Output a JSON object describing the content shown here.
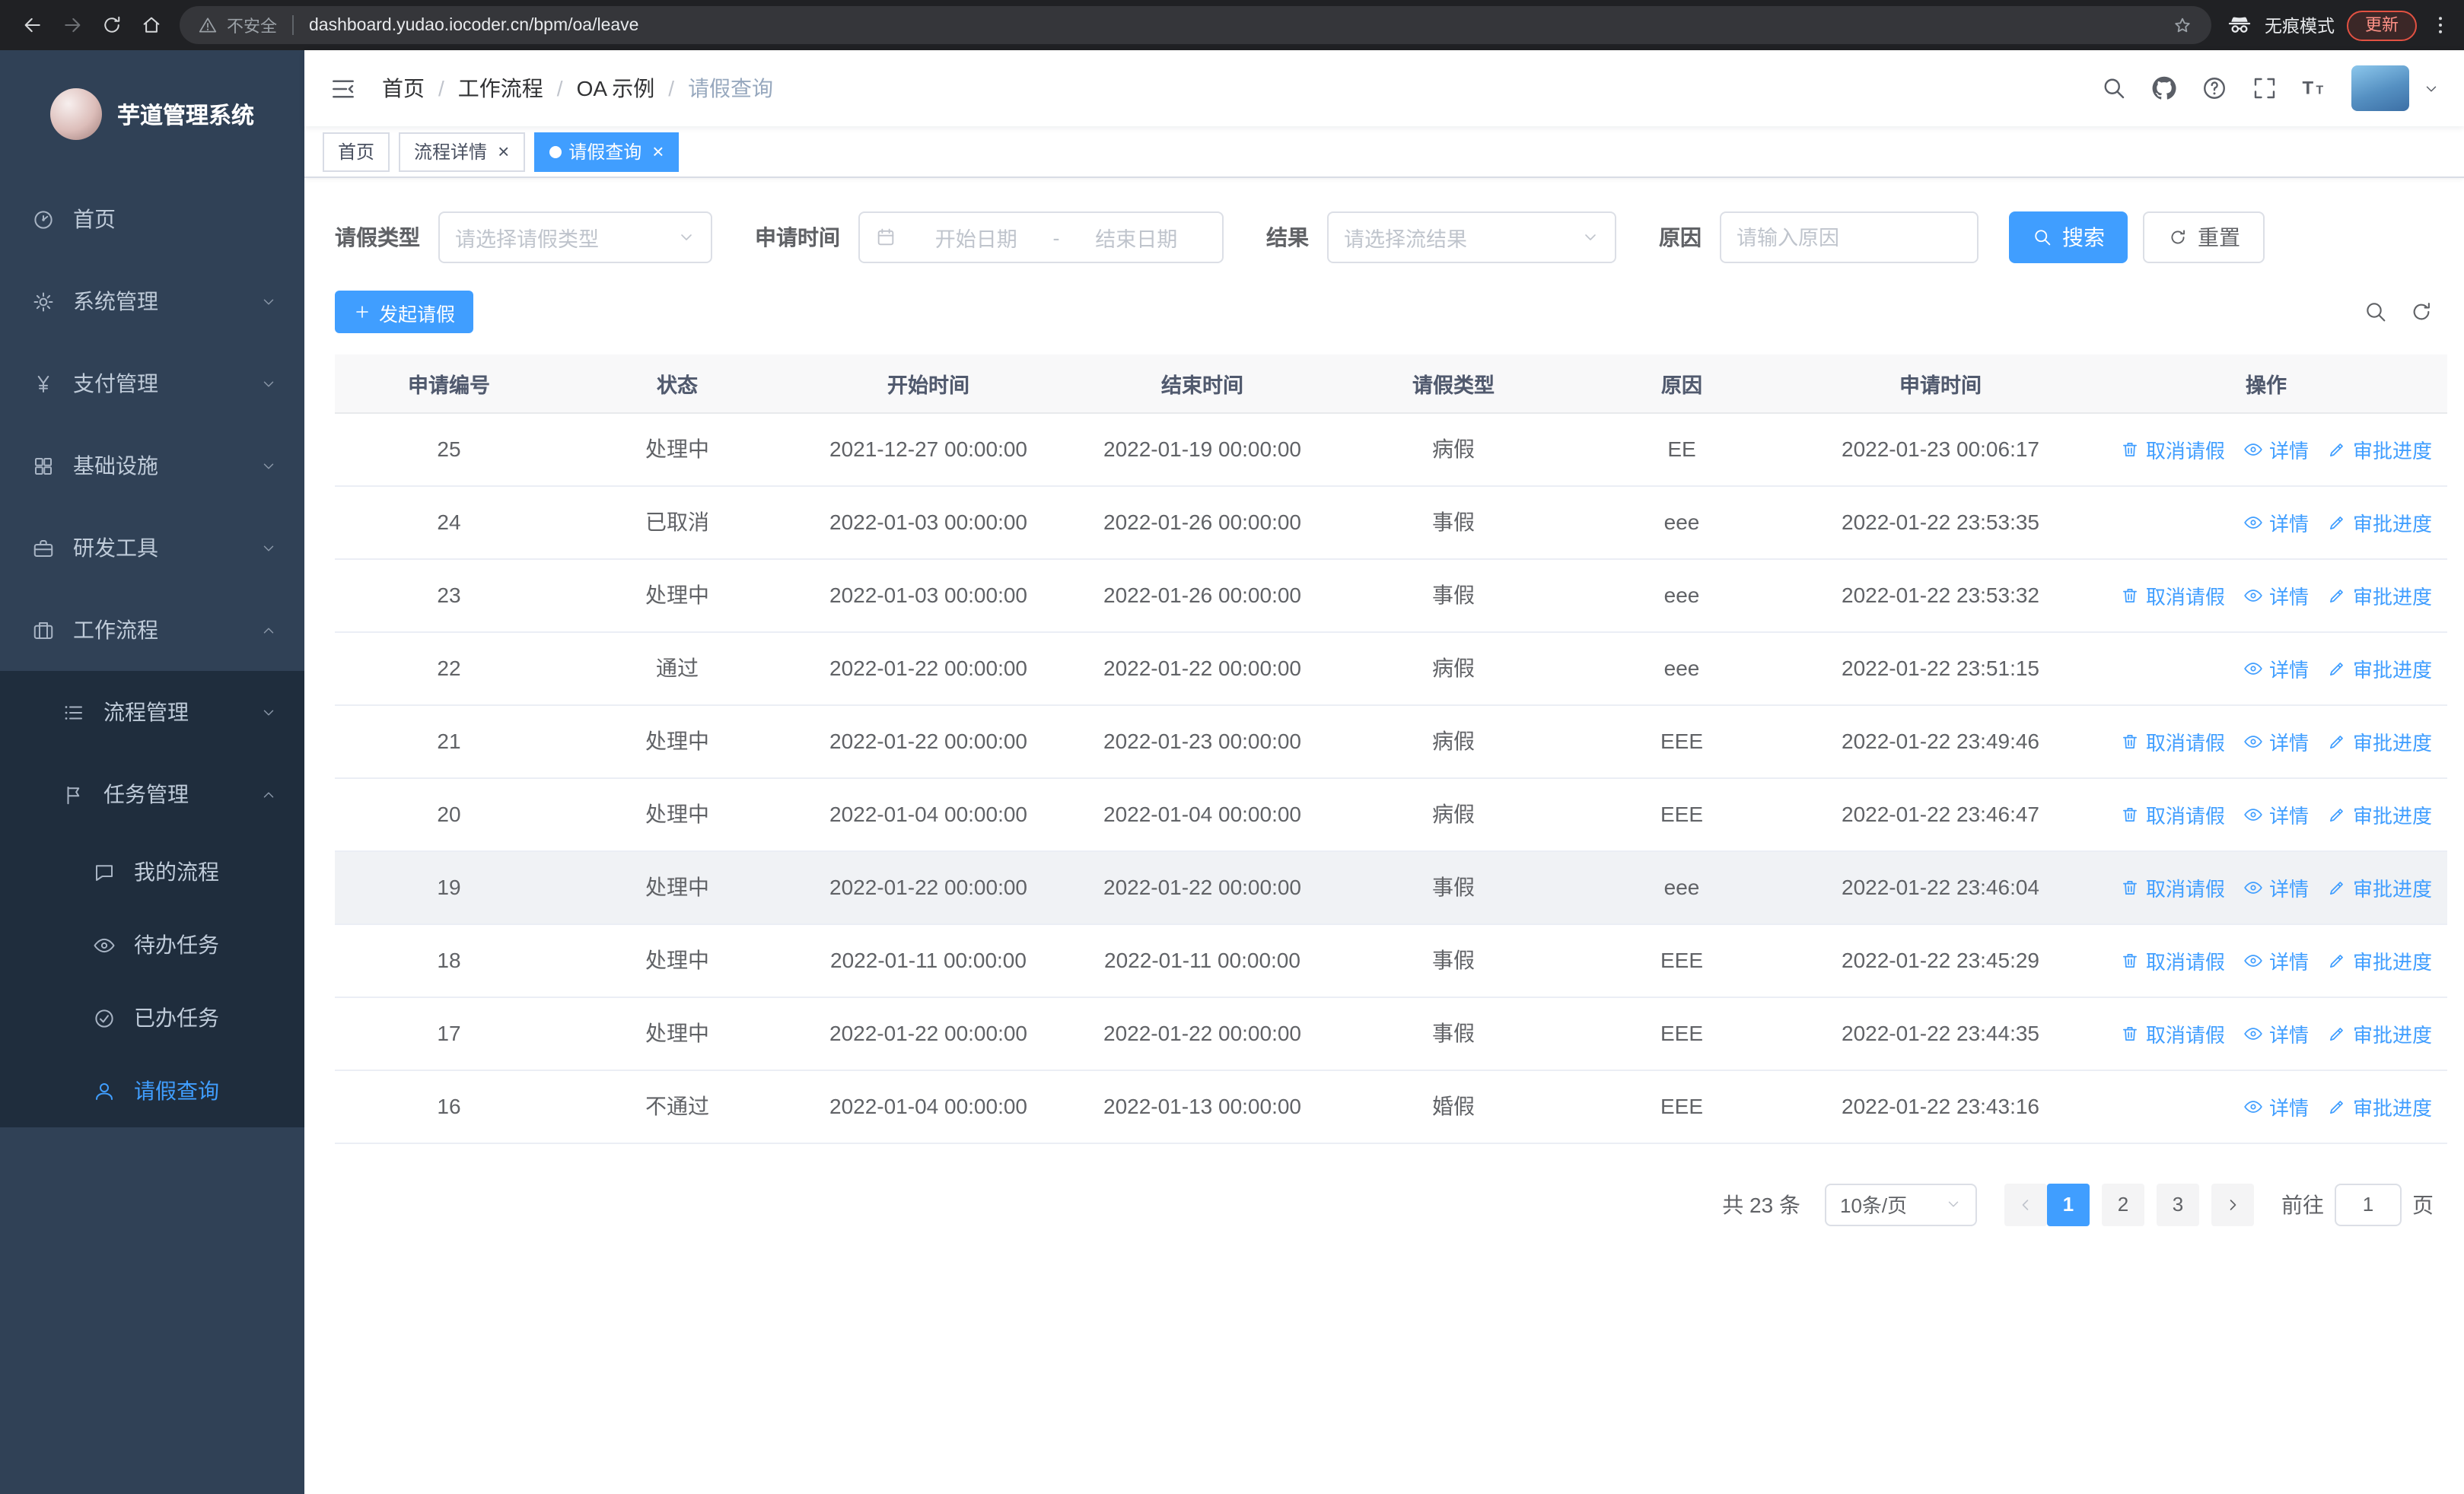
{
  "colors": {
    "primary": "#409eff",
    "sidebar_bg": "#304156",
    "submenu_bg": "#1f2d3d",
    "tab_active_bg": "#409eff"
  },
  "browser": {
    "security_label": "不安全",
    "url": "dashboard.yudao.iocoder.cn/bpm/oa/leave",
    "incognito_label": "无痕模式",
    "update_label": "更新"
  },
  "sidebar": {
    "logo_title": "芋道管理系统",
    "menu": [
      {
        "name": "home",
        "label": "首页",
        "icon": "dashboard-icon",
        "level": 1,
        "expandable": false,
        "expanded": false,
        "active": false
      },
      {
        "name": "system-mgmt",
        "label": "系统管理",
        "icon": "gear-icon",
        "level": 1,
        "expandable": true,
        "expanded": false,
        "active": false
      },
      {
        "name": "payment-mgmt",
        "label": "支付管理",
        "icon": "yen-icon",
        "level": 1,
        "expandable": true,
        "expanded": false,
        "active": false
      },
      {
        "name": "infrastructure",
        "label": "基础设施",
        "icon": "grid-icon",
        "level": 1,
        "expandable": true,
        "expanded": false,
        "active": false
      },
      {
        "name": "dev-tools",
        "label": "研发工具",
        "icon": "briefcase-icon",
        "level": 1,
        "expandable": true,
        "expanded": false,
        "active": false
      },
      {
        "name": "workflow",
        "label": "工作流程",
        "icon": "suitcase-icon",
        "level": 1,
        "expandable": true,
        "expanded": true,
        "active": false
      },
      {
        "name": "process-mgmt",
        "label": "流程管理",
        "icon": "list-icon",
        "level": 2,
        "expandable": true,
        "expanded": false,
        "active": false
      },
      {
        "name": "task-mgmt",
        "label": "任务管理",
        "icon": "flag-icon",
        "level": 2,
        "expandable": true,
        "expanded": true,
        "active": false
      },
      {
        "name": "my-process",
        "label": "我的流程",
        "icon": "chat-icon",
        "level": 3,
        "expandable": false,
        "expanded": false,
        "active": false
      },
      {
        "name": "todo-tasks",
        "label": "待办任务",
        "icon": "eye-icon",
        "level": 3,
        "expandable": false,
        "expanded": false,
        "active": false
      },
      {
        "name": "done-tasks",
        "label": "已办任务",
        "icon": "check-icon",
        "level": 3,
        "expandable": false,
        "expanded": false,
        "active": false
      },
      {
        "name": "leave-query",
        "label": "请假查询",
        "icon": "user-icon",
        "level": 3,
        "expandable": false,
        "expanded": false,
        "active": true
      }
    ]
  },
  "header": {
    "breadcrumbs": [
      "首页",
      "工作流程",
      "OA 示例",
      "请假查询"
    ],
    "separator": "/"
  },
  "tabs": [
    {
      "name": "tab-home",
      "label": "首页",
      "closable": false,
      "active": false
    },
    {
      "name": "tab-process-detail",
      "label": "流程详情",
      "closable": true,
      "active": false
    },
    {
      "name": "tab-leave-query",
      "label": "请假查询",
      "closable": true,
      "active": true
    }
  ],
  "filters": {
    "leave_type_label": "请假类型",
    "leave_type_placeholder": "请选择请假类型",
    "apply_time_label": "申请时间",
    "start_date_placeholder": "开始日期",
    "range_separator": "-",
    "end_date_placeholder": "结束日期",
    "result_label": "结果",
    "result_placeholder": "请选择流结果",
    "reason_label": "原因",
    "reason_placeholder": "请输入原因",
    "search_label": "搜索",
    "reset_label": "重置"
  },
  "toolbar": {
    "create_label": "发起请假"
  },
  "table": {
    "headers": [
      "申请编号",
      "状态",
      "开始时间",
      "结束时间",
      "请假类型",
      "原因",
      "申请时间",
      "操作"
    ],
    "col_keys": [
      "id",
      "status",
      "start-time",
      "end-time",
      "leave-type",
      "reason",
      "apply-time"
    ],
    "action_labels": {
      "cancel": "取消请假",
      "detail": "详情",
      "progress": "审批进度"
    },
    "action_icons": {
      "cancel": "trash-icon",
      "detail": "view-icon",
      "progress": "edit-icon"
    },
    "rows": [
      {
        "id": "25",
        "status": "处理中",
        "start": "2021-12-27 00:00:00",
        "end": "2022-01-19 00:00:00",
        "type": "病假",
        "reason": "EE",
        "applied": "2022-01-23 00:06:17",
        "actions": [
          "cancel",
          "detail",
          "progress"
        ],
        "highlight": false
      },
      {
        "id": "24",
        "status": "已取消",
        "start": "2022-01-03 00:00:00",
        "end": "2022-01-26 00:00:00",
        "type": "事假",
        "reason": "eee",
        "applied": "2022-01-22 23:53:35",
        "actions": [
          "detail",
          "progress"
        ],
        "highlight": false
      },
      {
        "id": "23",
        "status": "处理中",
        "start": "2022-01-03 00:00:00",
        "end": "2022-01-26 00:00:00",
        "type": "事假",
        "reason": "eee",
        "applied": "2022-01-22 23:53:32",
        "actions": [
          "cancel",
          "detail",
          "progress"
        ],
        "highlight": false
      },
      {
        "id": "22",
        "status": "通过",
        "start": "2022-01-22 00:00:00",
        "end": "2022-01-22 00:00:00",
        "type": "病假",
        "reason": "eee",
        "applied": "2022-01-22 23:51:15",
        "actions": [
          "detail",
          "progress"
        ],
        "highlight": false
      },
      {
        "id": "21",
        "status": "处理中",
        "start": "2022-01-22 00:00:00",
        "end": "2022-01-23 00:00:00",
        "type": "病假",
        "reason": "EEE",
        "applied": "2022-01-22 23:49:46",
        "actions": [
          "cancel",
          "detail",
          "progress"
        ],
        "highlight": false
      },
      {
        "id": "20",
        "status": "处理中",
        "start": "2022-01-04 00:00:00",
        "end": "2022-01-04 00:00:00",
        "type": "病假",
        "reason": "EEE",
        "applied": "2022-01-22 23:46:47",
        "actions": [
          "cancel",
          "detail",
          "progress"
        ],
        "highlight": false
      },
      {
        "id": "19",
        "status": "处理中",
        "start": "2022-01-22 00:00:00",
        "end": "2022-01-22 00:00:00",
        "type": "事假",
        "reason": "eee",
        "applied": "2022-01-22 23:46:04",
        "actions": [
          "cancel",
          "detail",
          "progress"
        ],
        "highlight": true
      },
      {
        "id": "18",
        "status": "处理中",
        "start": "2022-01-11 00:00:00",
        "end": "2022-01-11 00:00:00",
        "type": "事假",
        "reason": "EEE",
        "applied": "2022-01-22 23:45:29",
        "actions": [
          "cancel",
          "detail",
          "progress"
        ],
        "highlight": false
      },
      {
        "id": "17",
        "status": "处理中",
        "start": "2022-01-22 00:00:00",
        "end": "2022-01-22 00:00:00",
        "type": "事假",
        "reason": "EEE",
        "applied": "2022-01-22 23:44:35",
        "actions": [
          "cancel",
          "detail",
          "progress"
        ],
        "highlight": false
      },
      {
        "id": "16",
        "status": "不通过",
        "start": "2022-01-04 00:00:00",
        "end": "2022-01-13 00:00:00",
        "type": "婚假",
        "reason": "EEE",
        "applied": "2022-01-22 23:43:16",
        "actions": [
          "detail",
          "progress"
        ],
        "highlight": false
      }
    ]
  },
  "pagination": {
    "total_label": "共 23 条",
    "page_size_value": "10条/页",
    "pages": [
      "1",
      "2",
      "3"
    ],
    "active_page": "1",
    "goto_label": "前往",
    "goto_value": "1",
    "page_unit": "页"
  }
}
